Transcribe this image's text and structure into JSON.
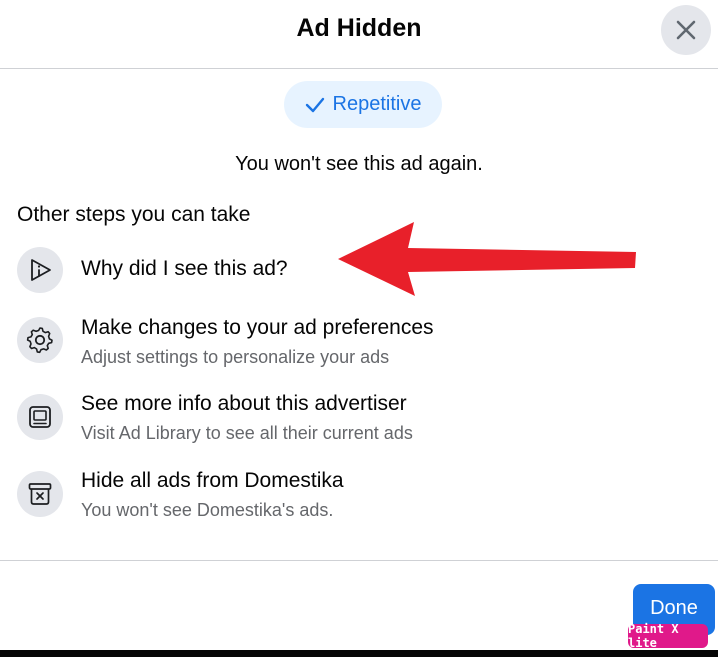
{
  "dialog": {
    "title": "Ad Hidden",
    "close_icon": "close-icon"
  },
  "feedback": {
    "chip_label": "Repetitive",
    "chip_icon": "check-icon",
    "confirmation": "You won't see this ad again."
  },
  "steps": {
    "section_title": "Other steps you can take",
    "items": [
      {
        "icon": "play-info-icon",
        "label": "Why did I see this ad?",
        "sub": ""
      },
      {
        "icon": "gear-icon",
        "label": "Make changes to your ad preferences",
        "sub": "Adjust settings to personalize your ads"
      },
      {
        "icon": "library-icon",
        "label": "See more info about this advertiser",
        "sub": "Visit Ad Library to see all their current ads"
      },
      {
        "icon": "hide-box-icon",
        "label": "Hide all ads from Domestika",
        "sub": "You won't see Domestika's ads."
      }
    ]
  },
  "footer": {
    "done_label": "Done"
  },
  "watermark": {
    "text": "Paint X lite"
  },
  "colors": {
    "accent": "#1b74e4",
    "chip_bg": "#e7f3ff",
    "icon_bg": "#e4e6eb",
    "annotation_arrow": "#e8202a",
    "watermark_bg": "#e0198a"
  }
}
